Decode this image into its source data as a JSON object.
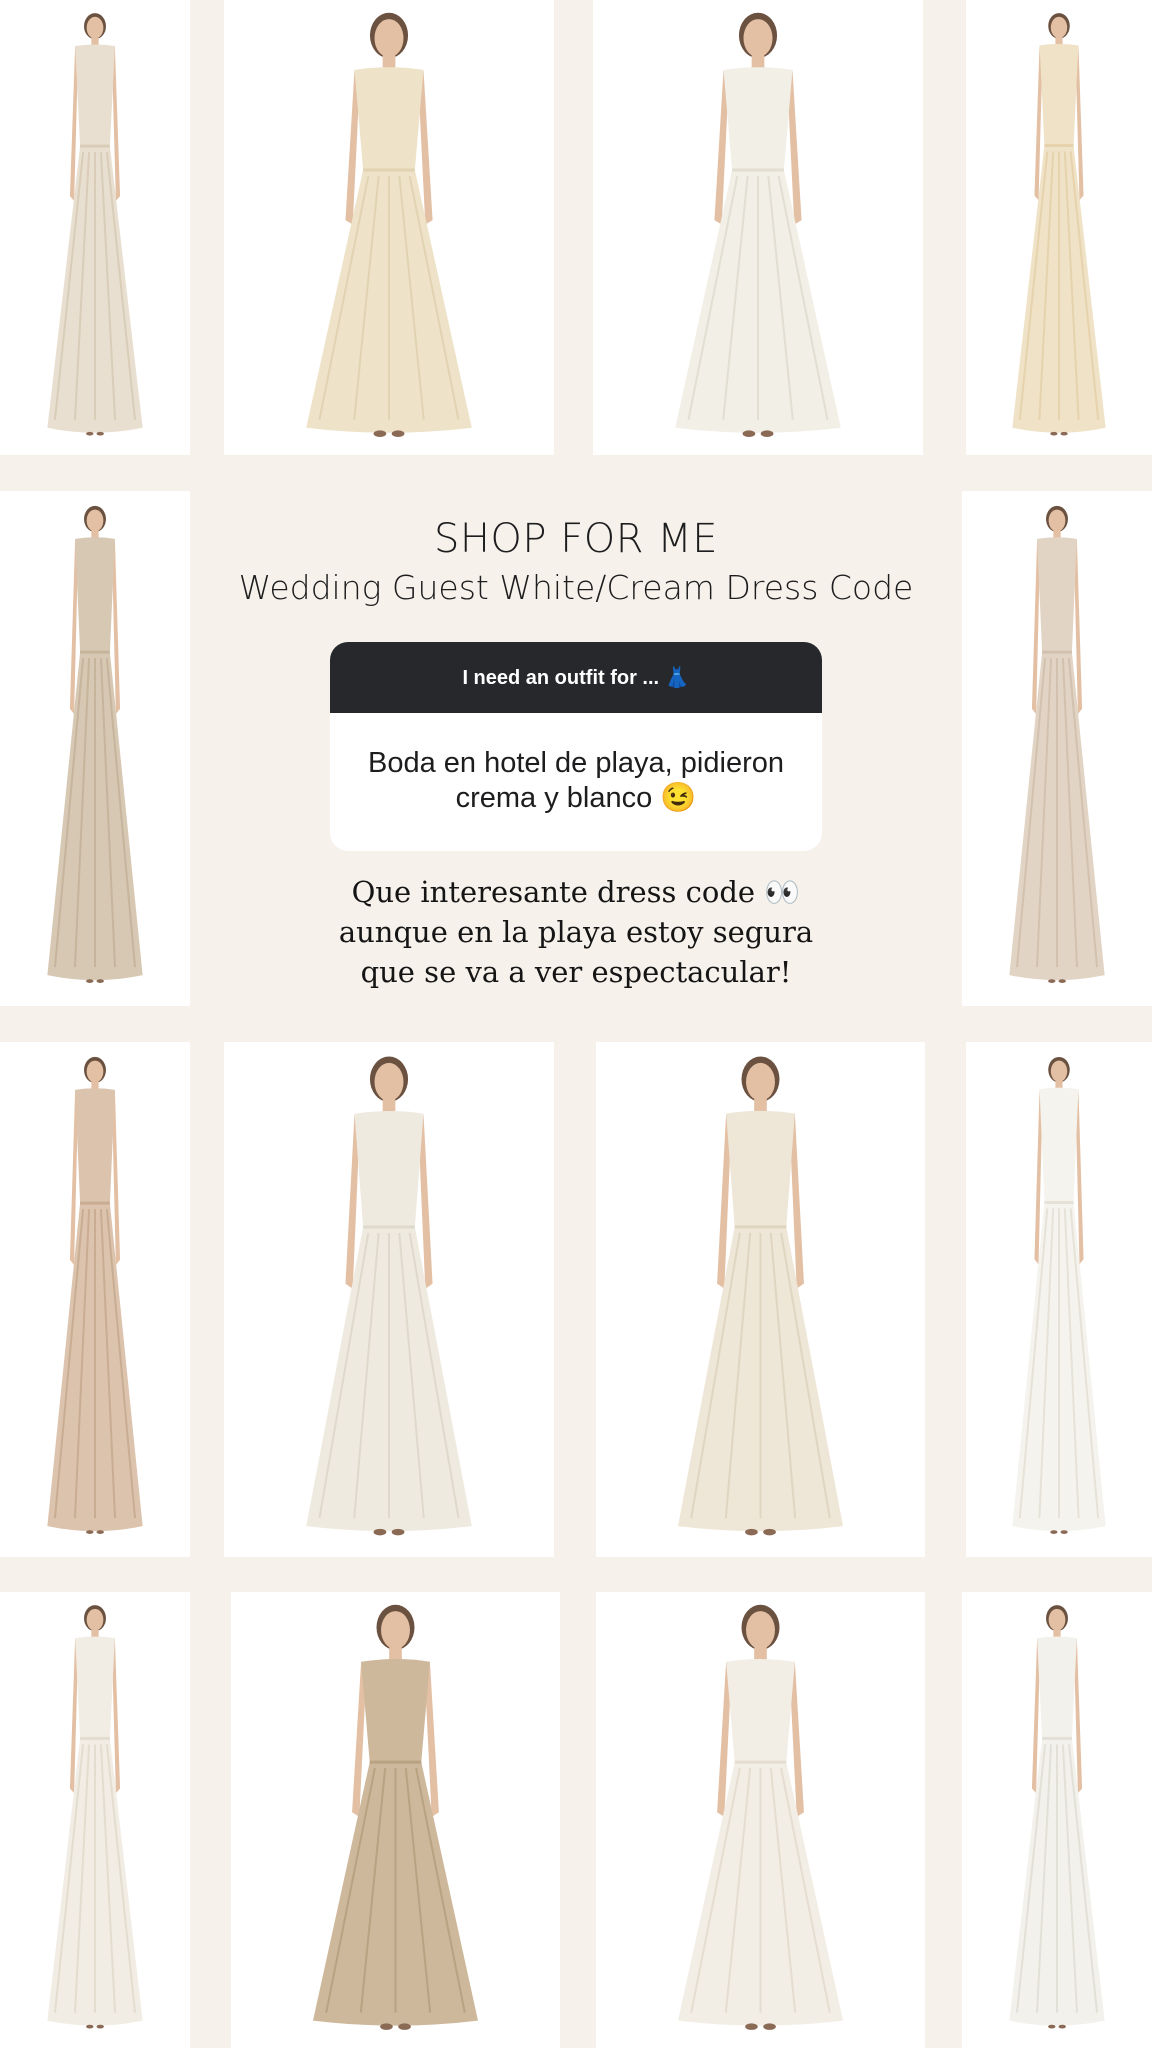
{
  "story": {
    "title": "SHOP FOR ME",
    "subtitle": "Wedding Guest White/Cream Dress Code",
    "question_prompt": "I need an outfit for ... 👗",
    "question_answer": "Boda en hotel de playa, pidieron crema y blanco 😉",
    "reply_lines": [
      "Que interesante dress code 👀",
      "aunque en la playa estoy segura",
      "que se va a ver espectacular!"
    ]
  },
  "product_tiles": [
    {
      "name": "cream-spaghetti-strap-maxi-dress",
      "dress": "#e8dfd0",
      "accent": "#d9cdb8"
    },
    {
      "name": "one-shoulder-draped-maxi-dress",
      "dress": "#eee3c8",
      "accent": "#e1d3b2"
    },
    {
      "name": "white-corset-column-gown",
      "dress": "#f1efe6",
      "accent": "#e2ded2"
    },
    {
      "name": "embellished-tank-maxi-dress",
      "dress": "#f0e2c6",
      "accent": "#e6d3ad"
    },
    {
      "name": "strapless-slit-satin-gown",
      "dress": "#d7c8b4",
      "accent": "#c6b59c"
    },
    {
      "name": "strapless-peplum-maxi-set",
      "dress": "#e2d4c4",
      "accent": "#d2c1ae"
    },
    {
      "name": "blush-satin-belted-dress",
      "dress": "#dcc3ad",
      "accent": "#c8ad93"
    },
    {
      "name": "ivory-satin-bias-gown",
      "dress": "#eeeae0",
      "accent": "#dfd9cc"
    },
    {
      "name": "crochet-top-column-dress",
      "dress": "#eee6d6",
      "accent": "#e0d5c0"
    },
    {
      "name": "ruffle-open-back-gown",
      "dress": "#f5f3ee",
      "accent": "#e6e2d8"
    },
    {
      "name": "one-shoulder-ivory-satin-dress",
      "dress": "#f1ede4",
      "accent": "#e3ddcf"
    },
    {
      "name": "taupe-satin-scarf-dress",
      "dress": "#cdb89c",
      "accent": "#b9a282"
    },
    {
      "name": "ivory-ruched-satin-gown",
      "dress": "#f2eee6",
      "accent": "#e4ddd0"
    },
    {
      "name": "white-draped-tie-dress",
      "dress": "#f3f1ec",
      "accent": "#e3e0d8"
    }
  ],
  "colors": {
    "background": "#f6f1ea",
    "tile": "#ffffff",
    "question_header": "#26282c"
  }
}
